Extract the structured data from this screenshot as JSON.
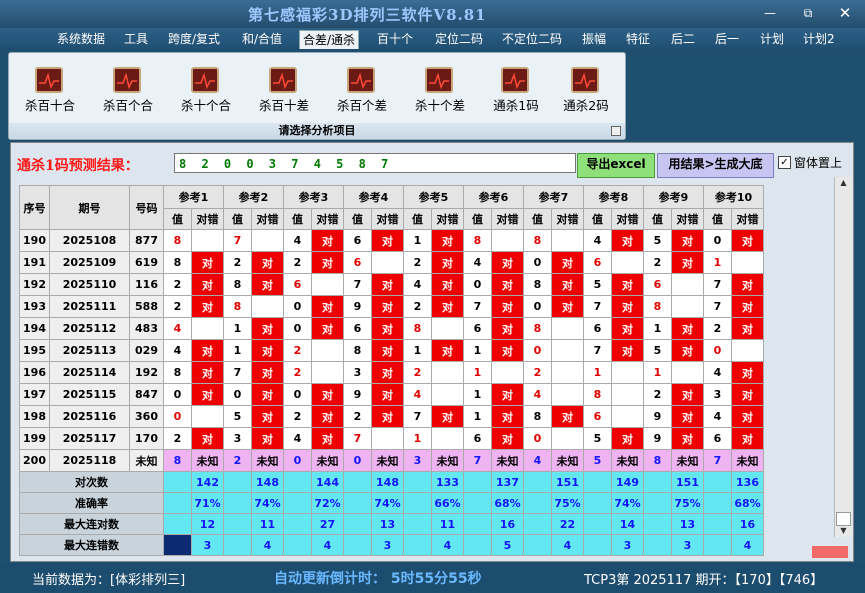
{
  "app": {
    "title": "第七感福彩3D排列三软件V8.81"
  },
  "menu": [
    "系统数据",
    "工具",
    "跨度/复式",
    "和/合值",
    "合差/通杀",
    "百十个",
    "定位二码",
    "不定位二码",
    "振幅",
    "特征",
    "后二",
    "后一",
    "计划",
    "计划2"
  ],
  "menu_active": "合差/通杀",
  "ribbon": {
    "buttons": [
      "杀百十合",
      "杀百个合",
      "杀十个合",
      "杀百十差",
      "杀百个差",
      "杀十个差",
      "通杀1码",
      "通杀2码"
    ],
    "footer": "请选择分析项目"
  },
  "prediction": {
    "label": "通杀1码预测结果：",
    "value": "8 2 0 0 3 7 4 5 8 7",
    "excel_button": "导出excel",
    "generate_button": "用结果>生成大底",
    "topmost_label": "窗体置上",
    "topmost_checked": true
  },
  "table": {
    "h_seq": "序号",
    "h_period": "期号",
    "h_code": "号码",
    "refs": [
      "参考1",
      "参考2",
      "参考3",
      "参考4",
      "参考5",
      "参考6",
      "参考7",
      "参考8",
      "参考9",
      "参考10"
    ],
    "sub_value": "值",
    "sub_result": "对错",
    "rows": [
      {
        "seq": "190",
        "period": "2025108",
        "code": "877",
        "vals": [
          "8",
          "7",
          "4",
          "6",
          "1",
          "8",
          "8",
          "4",
          "5",
          "0"
        ]
      },
      {
        "seq": "191",
        "period": "2025109",
        "code": "619",
        "vals": [
          "8",
          "2",
          "2",
          "6",
          "2",
          "4",
          "0",
          "6",
          "2",
          "1"
        ]
      },
      {
        "seq": "192",
        "period": "2025110",
        "code": "116",
        "vals": [
          "2",
          "8",
          "6",
          "7",
          "4",
          "0",
          "8",
          "5",
          "6",
          "7"
        ]
      },
      {
        "seq": "193",
        "period": "2025111",
        "code": "588",
        "vals": [
          "2",
          "8",
          "0",
          "9",
          "2",
          "7",
          "0",
          "7",
          "8",
          "7"
        ]
      },
      {
        "seq": "194",
        "period": "2025112",
        "code": "483",
        "vals": [
          "4",
          "1",
          "0",
          "6",
          "8",
          "6",
          "8",
          "6",
          "1",
          "2"
        ]
      },
      {
        "seq": "195",
        "period": "2025113",
        "code": "029",
        "vals": [
          "4",
          "1",
          "2",
          "8",
          "1",
          "1",
          "0",
          "7",
          "5",
          "0"
        ]
      },
      {
        "seq": "196",
        "period": "2025114",
        "code": "192",
        "vals": [
          "8",
          "7",
          "2",
          "3",
          "2",
          "1",
          "2",
          "1",
          "1",
          "4"
        ]
      },
      {
        "seq": "197",
        "period": "2025115",
        "code": "847",
        "vals": [
          "0",
          "0",
          "0",
          "9",
          "4",
          "1",
          "4",
          "8",
          "2",
          "3"
        ]
      },
      {
        "seq": "198",
        "period": "2025116",
        "code": "360",
        "vals": [
          "0",
          "5",
          "2",
          "2",
          "7",
          "1",
          "8",
          "6",
          "9",
          "4"
        ]
      },
      {
        "seq": "199",
        "period": "2025117",
        "code": "170",
        "vals": [
          "2",
          "3",
          "4",
          "7",
          "1",
          "6",
          "0",
          "5",
          "9",
          "6"
        ]
      }
    ],
    "result_right": "对",
    "last_row": {
      "seq": "200",
      "period": "2025118",
      "code": "未知",
      "vals": [
        "8",
        "2",
        "0",
        "0",
        "3",
        "7",
        "4",
        "5",
        "8",
        "7"
      ],
      "result": "未知"
    },
    "stats": [
      {
        "label": "对次数",
        "values": [
          "142",
          "148",
          "144",
          "148",
          "133",
          "137",
          "151",
          "149",
          "151",
          "136"
        ]
      },
      {
        "label": "准确率",
        "values": [
          "71%",
          "74%",
          "72%",
          "74%",
          "66%",
          "68%",
          "75%",
          "74%",
          "75%",
          "68%"
        ]
      },
      {
        "label": "最大连对数",
        "values": [
          "12",
          "11",
          "27",
          "13",
          "11",
          "16",
          "22",
          "14",
          "13",
          "16"
        ]
      },
      {
        "label": "最大连错数",
        "values": [
          "3",
          "4",
          "4",
          "3",
          "4",
          "5",
          "4",
          "3",
          "3",
          "4"
        ]
      }
    ]
  },
  "status": {
    "current": "当前数据为：[体彩排列三]",
    "countdown": "自动更新倒计时：  5时55分55秒",
    "issue": "TCP3第 2025117 期开：【170】【746】"
  }
}
